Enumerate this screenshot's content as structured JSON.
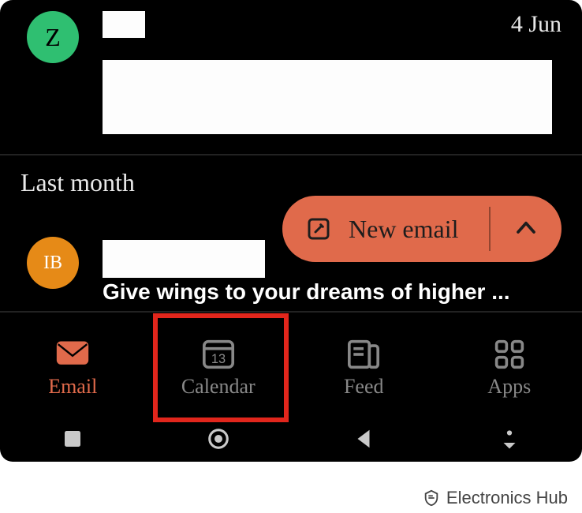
{
  "row1": {
    "avatar_letter": "Z",
    "avatar_color": "#2fbf71",
    "date": "4 Jun"
  },
  "section_label": "Last month",
  "row2": {
    "avatar_letter": "IB",
    "avatar_color": "#e68a17",
    "subject_visible": "Give wings to your dreams of higher ..."
  },
  "fab": {
    "label": "New email"
  },
  "nav": {
    "email": "Email",
    "calendar": "Calendar",
    "calendar_day": "13",
    "feed": "Feed",
    "apps": "Apps",
    "active": "email",
    "highlighted": "calendar"
  },
  "watermark": "Electronics Hub"
}
